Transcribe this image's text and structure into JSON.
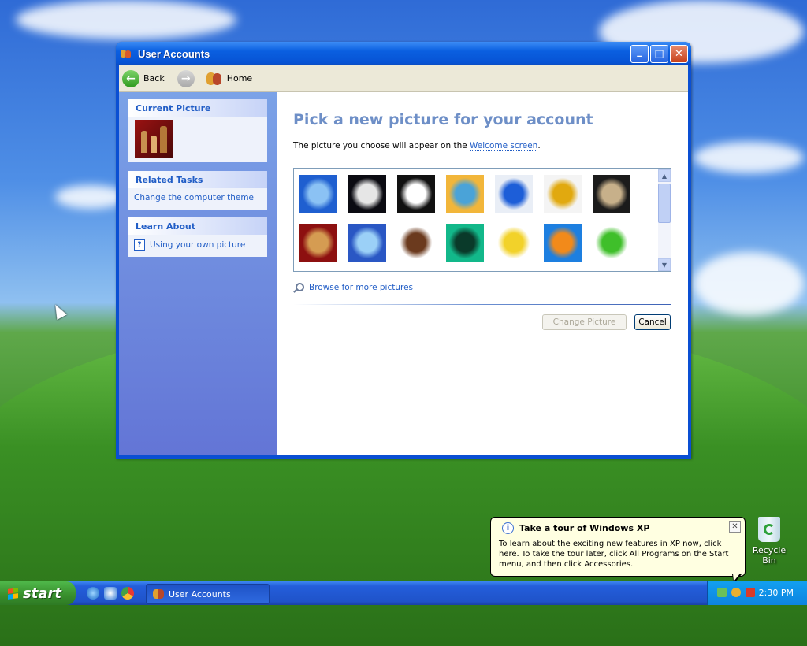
{
  "window": {
    "title": "User Accounts",
    "controls": {
      "minimize": "_",
      "maximize": "□",
      "close": "✕"
    }
  },
  "toolbar": {
    "back_label": "Back",
    "home_label": "Home"
  },
  "leftpane": {
    "current_picture": {
      "header": "Current Picture"
    },
    "related_tasks": {
      "header": "Related Tasks",
      "items": [
        "Change the computer theme"
      ]
    },
    "learn_about": {
      "header": "Learn About",
      "items": [
        "Using your own picture"
      ]
    }
  },
  "main": {
    "heading": "Pick a new picture for your account",
    "subtext_before": "The picture you choose will appear on the ",
    "subtext_link": "Welcome screen",
    "subtext_after": ".",
    "pictures": [
      {
        "name": "airplane",
        "colors": [
          "#1f5fd0",
          "#8bc2f4"
        ]
      },
      {
        "name": "astronaut",
        "colors": [
          "#0b0b12",
          "#e6e6e6"
        ]
      },
      {
        "name": "soccer-ball",
        "colors": [
          "#111111",
          "#ffffff"
        ]
      },
      {
        "name": "beach-chair",
        "colors": [
          "#f2b63a",
          "#4aa3d8"
        ]
      },
      {
        "name": "butterfly",
        "colors": [
          "#e9eef6",
          "#1d5ed8"
        ]
      },
      {
        "name": "car",
        "colors": [
          "#f4f4f4",
          "#e1a90f"
        ]
      },
      {
        "name": "owl",
        "colors": [
          "#1b1b1b",
          "#c7b08a"
        ]
      },
      {
        "name": "chess",
        "colors": [
          "#8d1010",
          "#d59c52"
        ]
      },
      {
        "name": "dirt-bike",
        "colors": [
          "#2a57c4",
          "#9bd0f7"
        ]
      },
      {
        "name": "dog",
        "colors": [
          "#ffffff",
          "#6b3a1e"
        ]
      },
      {
        "name": "drip",
        "colors": [
          "#12b88a",
          "#0a3a2a"
        ]
      },
      {
        "name": "duck",
        "colors": [
          "#ffffff",
          "#f2d22a"
        ]
      },
      {
        "name": "fish",
        "colors": [
          "#1d7fe0",
          "#f28a1a"
        ]
      },
      {
        "name": "frog",
        "colors": [
          "#ffffff",
          "#3fbf2a"
        ]
      }
    ],
    "browse_label": "Browse for more pictures",
    "change_button": "Change Picture",
    "cancel_button": "Cancel"
  },
  "taskbar": {
    "start_label": "start",
    "task_label": "User Accounts",
    "clock": "2:30 PM"
  },
  "balloon": {
    "title": "Take a tour of Windows XP",
    "body": "To learn about the exciting new features in XP now, click here. To take the tour later, click All Programs on the Start menu, and then click Accessories."
  },
  "desktop": {
    "recycle_bin_label": "Recycle Bin"
  }
}
